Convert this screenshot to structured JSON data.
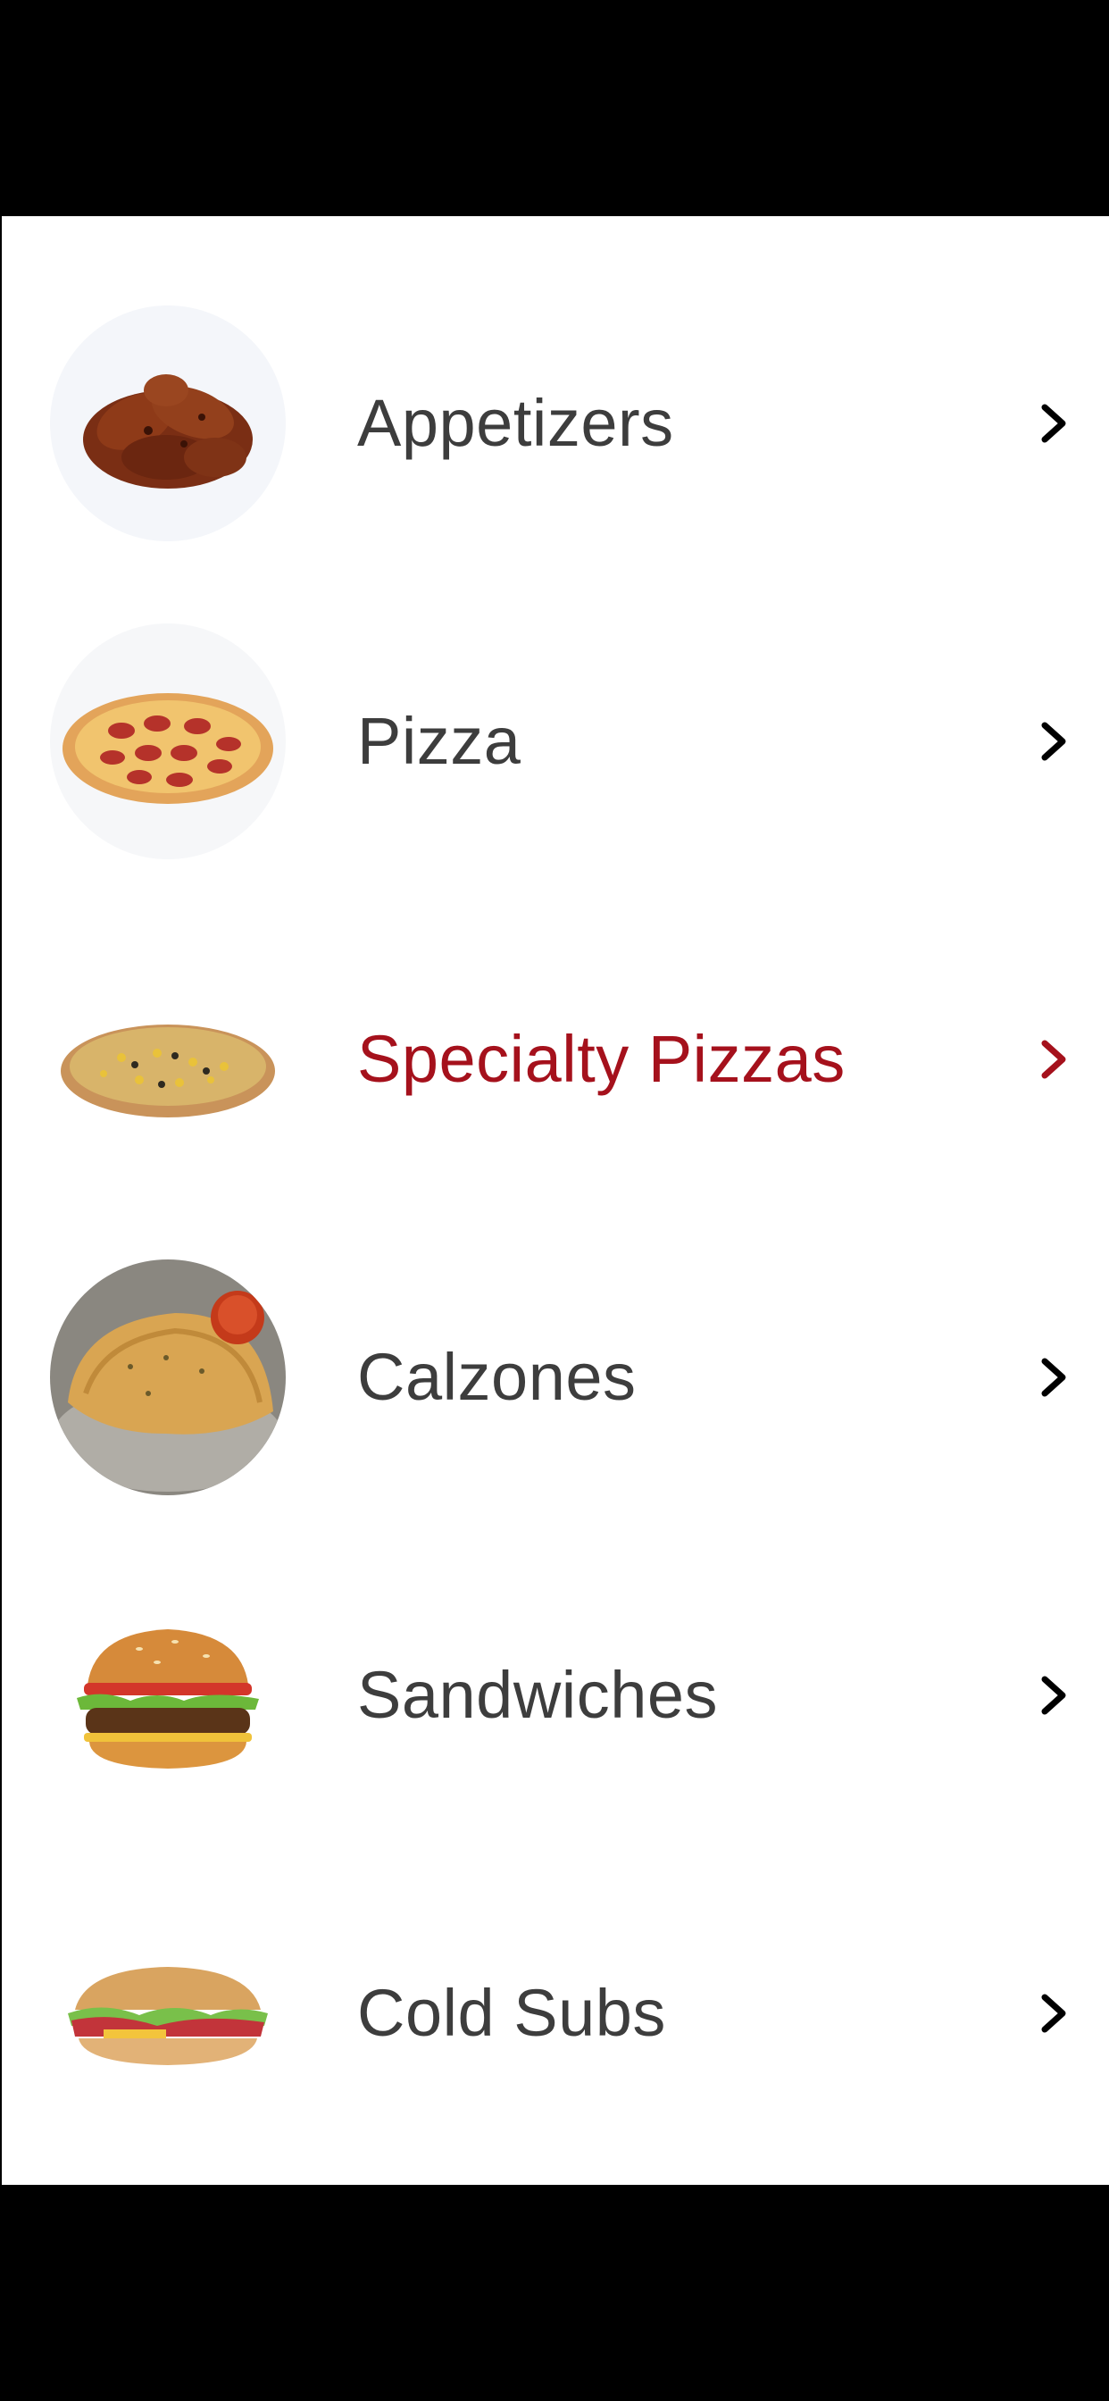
{
  "theme": {
    "text_color": "#3d3d3d",
    "active_color": "#a5111c",
    "chevron_color": "#000000",
    "background": "#ffffff",
    "system_bar_color": "#000000"
  },
  "menu": {
    "items": [
      {
        "label": "Appetizers",
        "icon": "chicken-wings-icon",
        "active": false
      },
      {
        "label": "Pizza",
        "icon": "pepperoni-pizza-icon",
        "active": false
      },
      {
        "label": "Specialty Pizzas",
        "icon": "specialty-pizza-icon",
        "active": true
      },
      {
        "label": "Calzones",
        "icon": "calzone-icon",
        "active": false
      },
      {
        "label": "Sandwiches",
        "icon": "burger-icon",
        "active": false
      },
      {
        "label": "Cold Subs",
        "icon": "sub-sandwich-icon",
        "active": false
      }
    ]
  }
}
